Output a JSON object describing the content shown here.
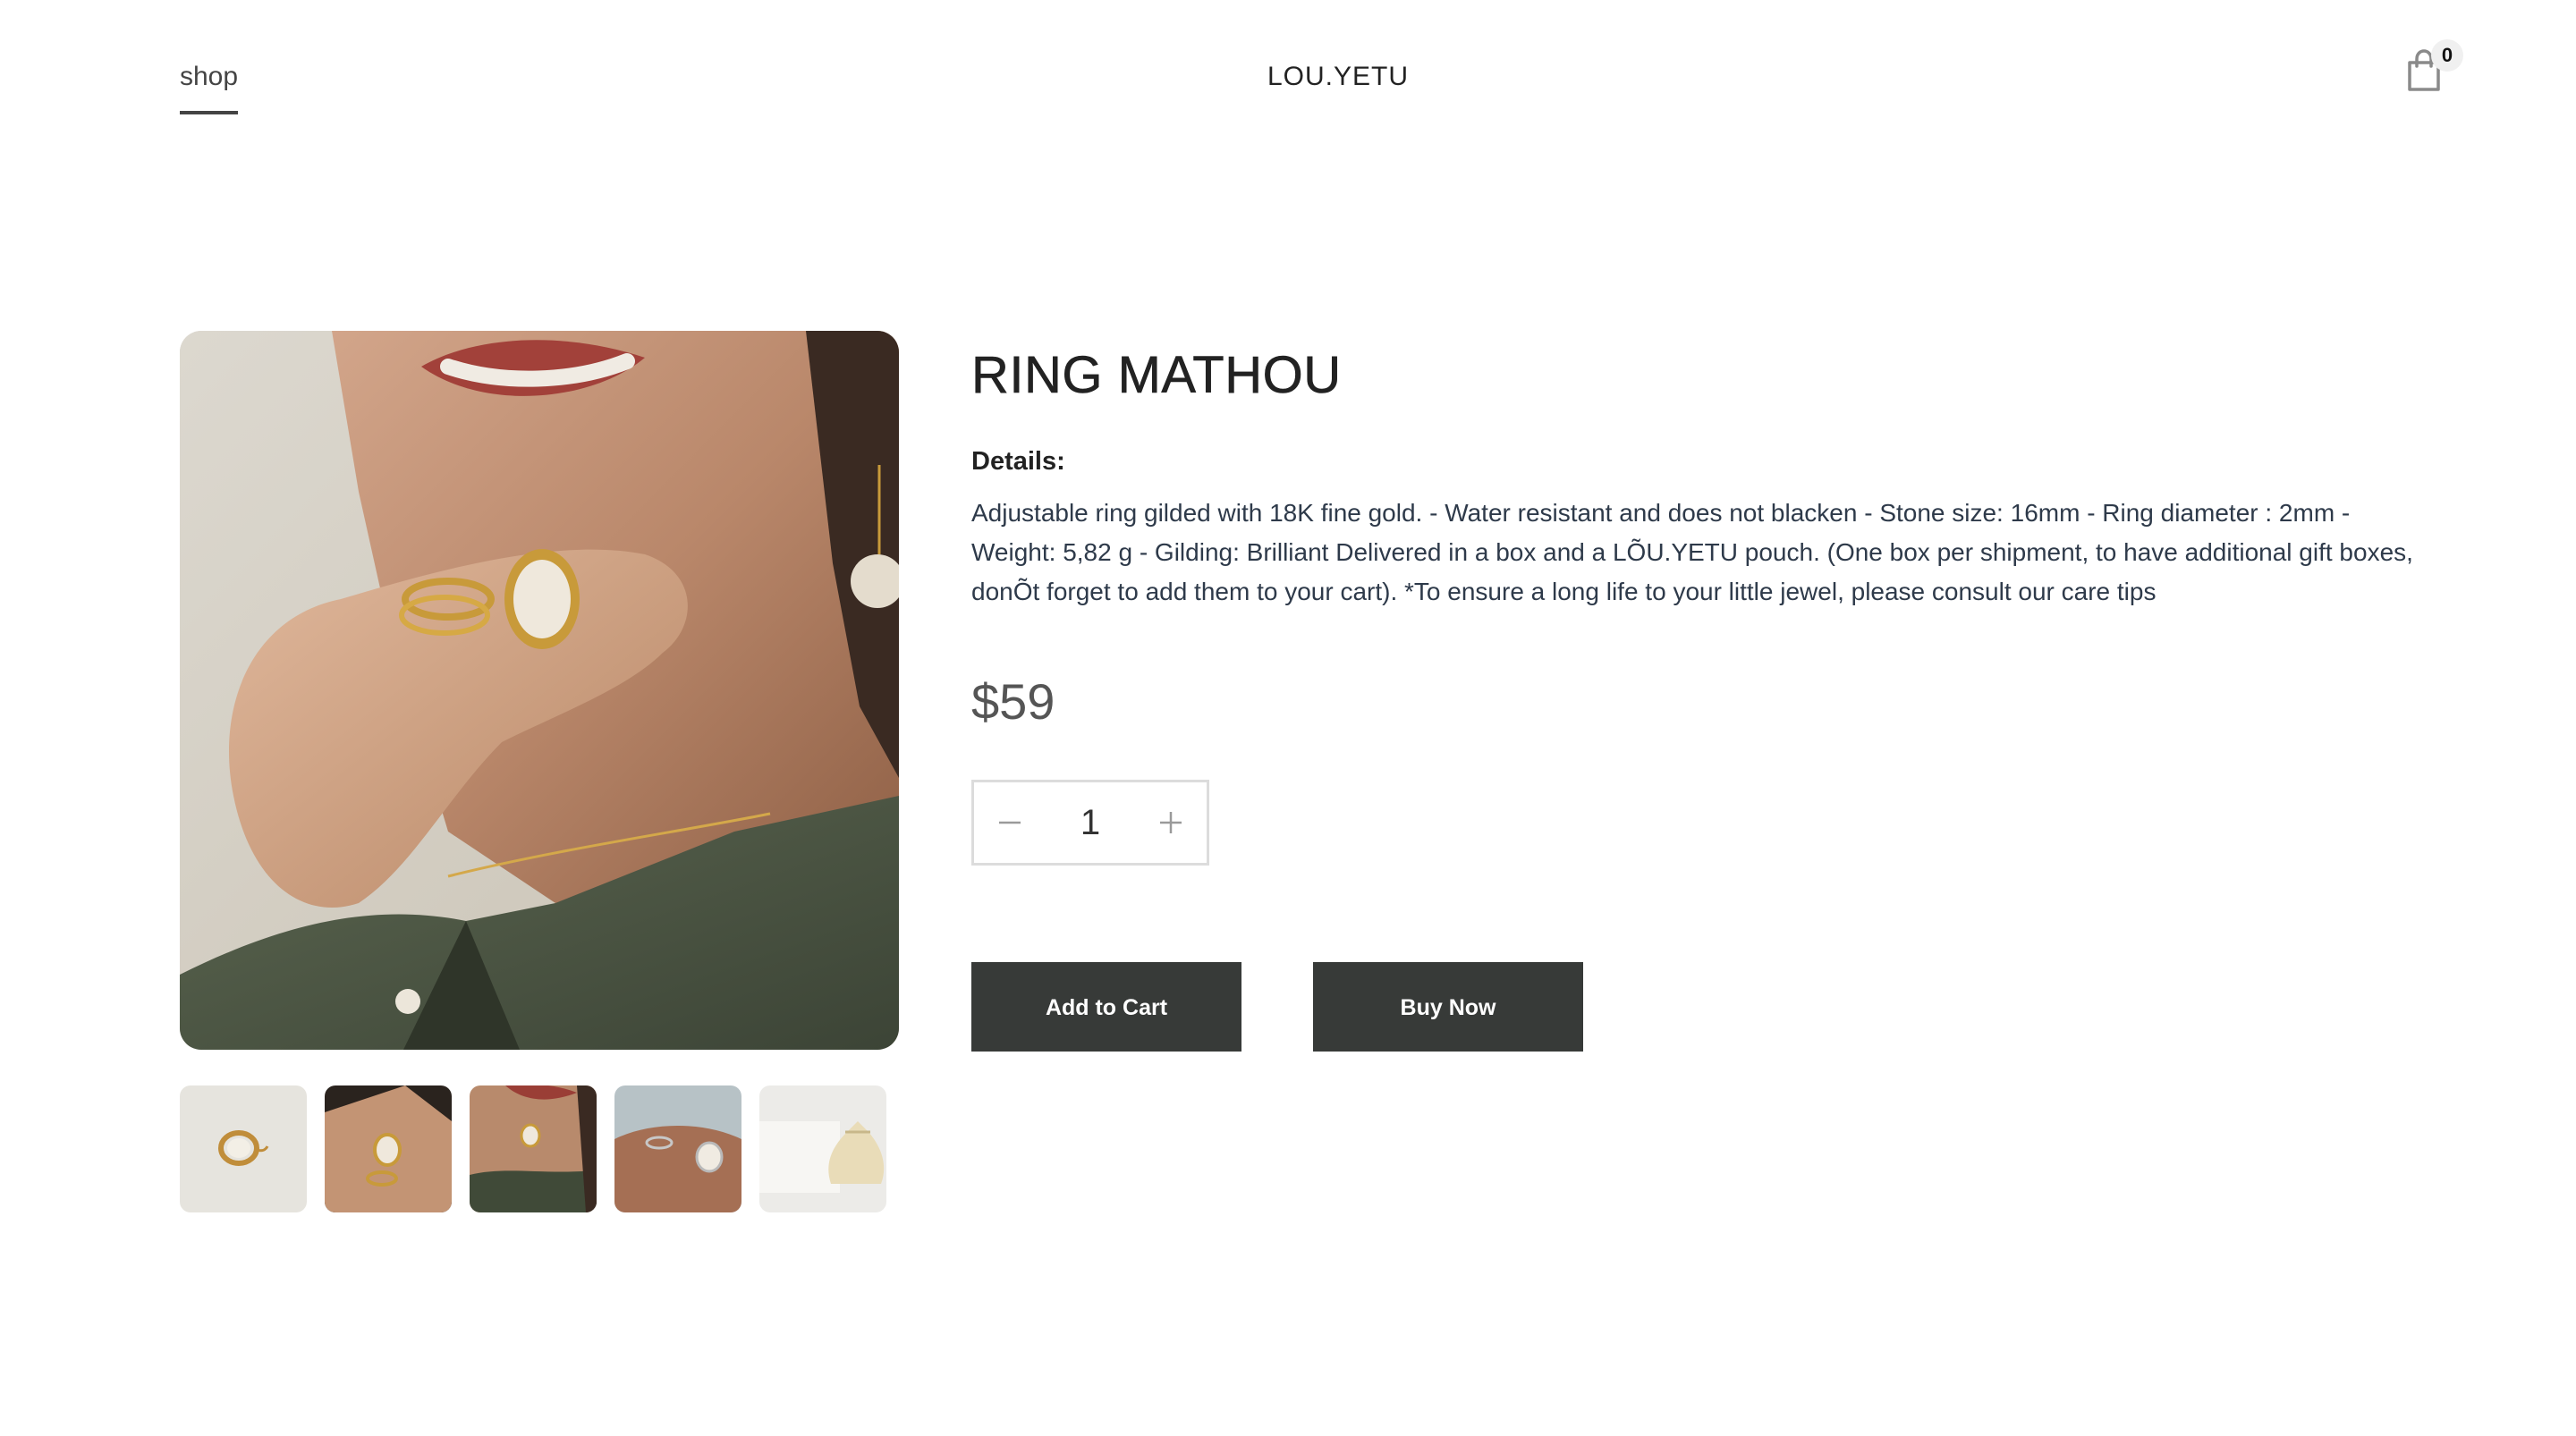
{
  "header": {
    "nav_shop": "shop",
    "brand": "LOU.YETU",
    "cart_count": "0",
    "cart_icon": "shopping-bag-icon"
  },
  "gallery": {
    "main_image": "model-wearing-rings-photo",
    "thumbnails": [
      {
        "name": "ring-product-thumb"
      },
      {
        "name": "hand-with-rings-thumb"
      },
      {
        "name": "model-portrait-thumb"
      },
      {
        "name": "hand-rings-closeup-thumb"
      },
      {
        "name": "gift-pouch-thumb"
      }
    ]
  },
  "product": {
    "title": "RING MATHOU",
    "details_label": "Details:",
    "description": "Adjustable ring gilded with 18K fine gold. - Water resistant and does not blacken - Stone size: 16mm - Ring diameter : 2mm - Weight: 5,82 g - Gilding: Brilliant Delivered in a box and a LÕU.YETU pouch. (One box per shipment, to have additional gift boxes, donÕt forget to add them to your cart). *To ensure a long life to your little jewel, please consult our care tips",
    "price": "$59",
    "quantity": "1",
    "add_to_cart_label": "Add to Cart",
    "buy_now_label": "Buy Now"
  },
  "colors": {
    "button_bg": "#373a38",
    "button_text": "#ffffff",
    "text_dark": "#222222",
    "description_text": "#2e3a4a"
  }
}
